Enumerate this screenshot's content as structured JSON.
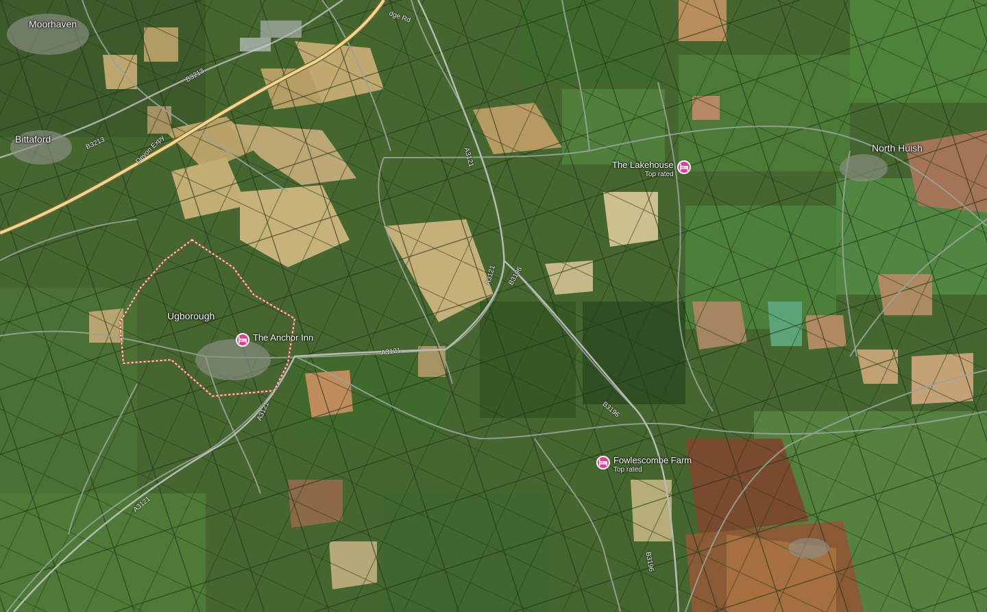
{
  "map": {
    "type": "satellite",
    "places": {
      "moorhaven": "Moorhaven",
      "bittaford": "Bittaford",
      "ugborough": "Ugborough",
      "north_huish": "North Huish"
    },
    "roads": {
      "devon_expy": "Devon Expy",
      "b3213_a": "B3213",
      "b3213_b": "B3213",
      "a3121_a": "A3121",
      "a3121_b": "A3121",
      "a3121_c": "A3121",
      "a3121_d": "A3121",
      "a3121_e": "A3121",
      "b3196_a": "B3196",
      "b3196_b": "B3196",
      "b3196_c": "B3196",
      "ridge_rd": "dge Rd"
    },
    "pois": [
      {
        "name": "The Lakehouse",
        "sub": "Top rated",
        "icon": "hotel-bed-icon"
      },
      {
        "name": "The Anchor Inn",
        "sub": "",
        "icon": "hotel-bed-icon"
      },
      {
        "name": "Fowlescombe Farm",
        "sub": "Top rated",
        "icon": "hotel-bed-icon"
      }
    ],
    "colors": {
      "poi_pin": "#e43d91",
      "boundary": "#f0c8c8",
      "motorway": "#f3d78a",
      "road": "#9aa39a"
    }
  }
}
